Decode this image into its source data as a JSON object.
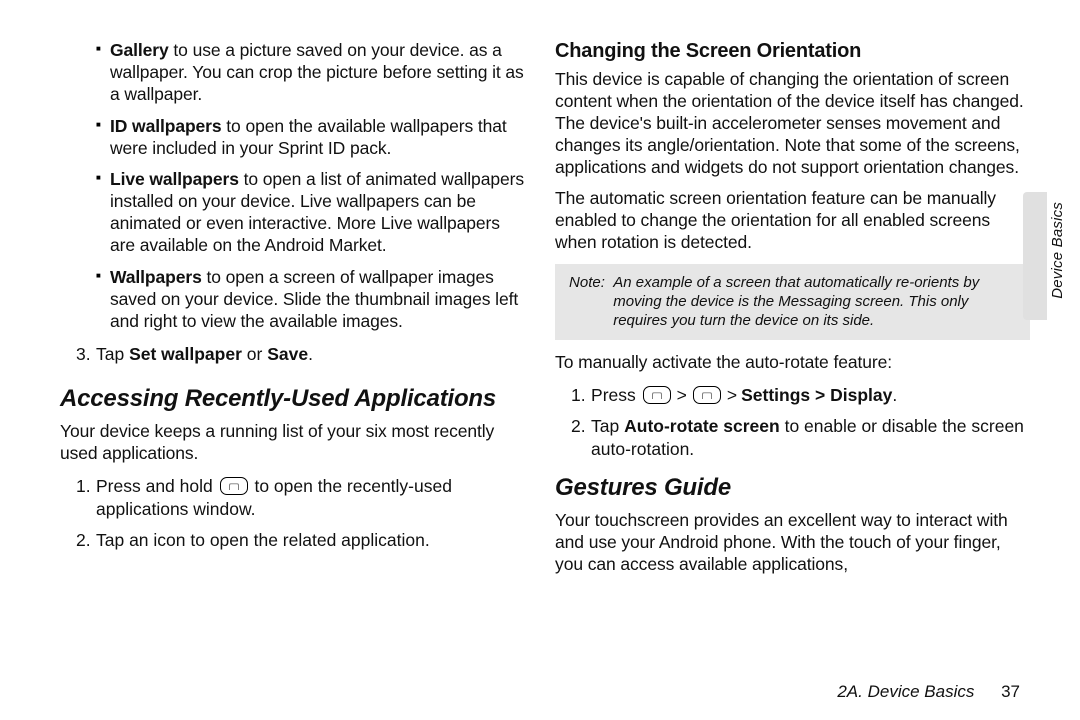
{
  "left": {
    "bullets": [
      {
        "bold": "Gallery",
        "text": " to use a picture saved on your device. as a wallpaper. You can crop the picture before setting it as a wallpaper."
      },
      {
        "bold": "ID wallpapers",
        "text": " to open the available wallpapers that were included in your Sprint ID pack."
      },
      {
        "bold": "Live wallpapers",
        "text": " to open a list of animated wallpapers installed on your device. Live wallpapers can be animated or even interactive. More Live wallpapers are available on the Android Market."
      },
      {
        "bold": "Wallpapers",
        "text": " to open a screen of wallpaper images saved on your device. Slide the thumbnail images left and right to view the available images."
      }
    ],
    "step3_pre": "Tap ",
    "step3_bold1": "Set wallpaper",
    "step3_mid": " or ",
    "step3_bold2": "Save",
    "step3_post": ".",
    "heading": "Accessing Recently-Used Applications",
    "para": "Your device keeps a running list of your six most recently used applications.",
    "steps": [
      {
        "n": "1.",
        "pre": "Press and hold ",
        "post": " to open the recently-used applications window."
      },
      {
        "n": "2.",
        "text": "Tap an icon to open the related application."
      }
    ]
  },
  "right": {
    "sub1": "Changing the Screen Orientation",
    "p1": "This device is capable of changing the orientation of screen content when the orientation of the device itself has changed. The device's built-in accelerometer senses movement and changes its angle/orientation. Note that some of the screens, applications and widgets do not support orientation changes.",
    "p2": "The automatic screen orientation feature can be manually enabled to change the orientation for all enabled screens when rotation is detected.",
    "note_label": "Note:",
    "note_body": "An example of a screen that automatically re-orients by moving the device is the Messaging screen. This only requires you turn the device on its side.",
    "p3": "To manually activate the auto-rotate feature:",
    "s1_n": "1.",
    "s1_pre": "Press ",
    "s1_settings": "Settings > Display",
    "s1_post": ".",
    "s2_n": "2.",
    "s2_pre": "Tap ",
    "s2_bold": "Auto-rotate screen",
    "s2_post": " to enable or disable the screen auto-rotation.",
    "heading2": "Gestures Guide",
    "p4": "Your touchscreen provides an excellent way to interact with and use your Android phone. With the touch of your finger, you can access available applications,"
  },
  "sidebar": "Device Basics",
  "footer_section": "2A. Device Basics",
  "footer_page": "37"
}
